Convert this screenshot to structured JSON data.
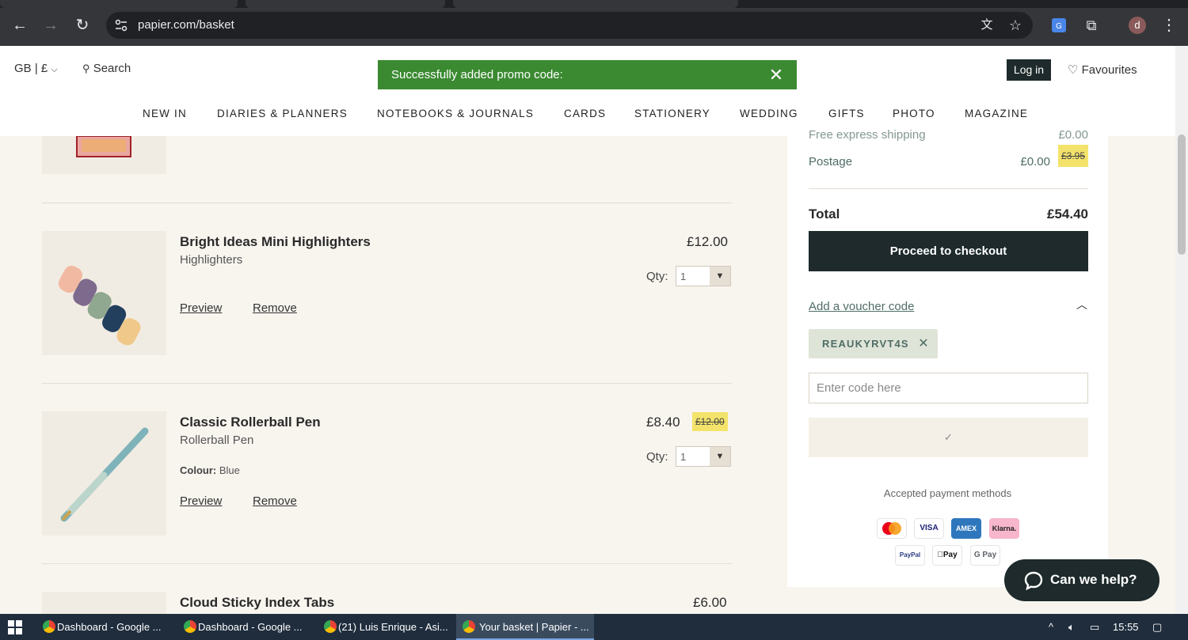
{
  "browser": {
    "url": "papier.com/basket",
    "profile_initial": "d"
  },
  "header": {
    "locale": "GB | £",
    "search_label": "Search",
    "toast_message": "Successfully added promo code:",
    "login_label": "Log in",
    "favourites_label": "Favourites",
    "menu": [
      "NEW IN",
      "DIARIES & PLANNERS",
      "NOTEBOOKS & JOURNALS",
      "CARDS",
      "STATIONERY",
      "WEDDING",
      "GIFTS",
      "PHOTO",
      "MAGAZINE"
    ]
  },
  "basket": {
    "items": [
      {
        "title": "Bright Ideas Mini Highlighters",
        "subtitle": "Highlighters",
        "price": "£12.00",
        "qty_label": "Qty:",
        "qty": "1",
        "preview_label": "Preview",
        "remove_label": "Remove"
      },
      {
        "title": "Classic Rollerball Pen",
        "subtitle": "Rollerball Pen",
        "colour_label": "Colour:",
        "colour_value": "Blue",
        "price": "£8.40",
        "price_old": "£12.00",
        "qty_label": "Qty:",
        "qty": "1",
        "preview_label": "Preview",
        "remove_label": "Remove"
      },
      {
        "title": "Cloud Sticky Index Tabs",
        "price": "£6.00"
      }
    ]
  },
  "summary": {
    "shipping_label": "Free express shipping",
    "shipping_value": "£0.00",
    "postage_label": "Postage",
    "postage_value": "£0.00",
    "postage_old": "£3.95",
    "total_label": "Total",
    "total_value": "£54.40",
    "checkout_label": "Proceed to checkout",
    "voucher_link": "Add a voucher code",
    "voucher_code": "REAUKYRVT4S",
    "code_placeholder": "Enter code here",
    "apply_symbol": "✓",
    "accepted_label": "Accepted payment methods",
    "payment_methods": [
      "VISA",
      "AMEX",
      "Klarna.",
      "PayPal",
      "Pay",
      "G Pay"
    ]
  },
  "help": {
    "label": "Can we help?"
  },
  "taskbar": {
    "items": [
      "Dashboard - Google ...",
      "Dashboard - Google ...",
      "(21) Luis Enrique - Asi...",
      "Your basket | Papier - ..."
    ],
    "time": "15:55"
  },
  "colors": {
    "toast_green": "#3b8a32",
    "dark_button": "#1e2a2b",
    "discount_highlight": "#f3e36a",
    "chip_bg": "#dfe4d8",
    "page_bg": "#f8f5ef"
  }
}
